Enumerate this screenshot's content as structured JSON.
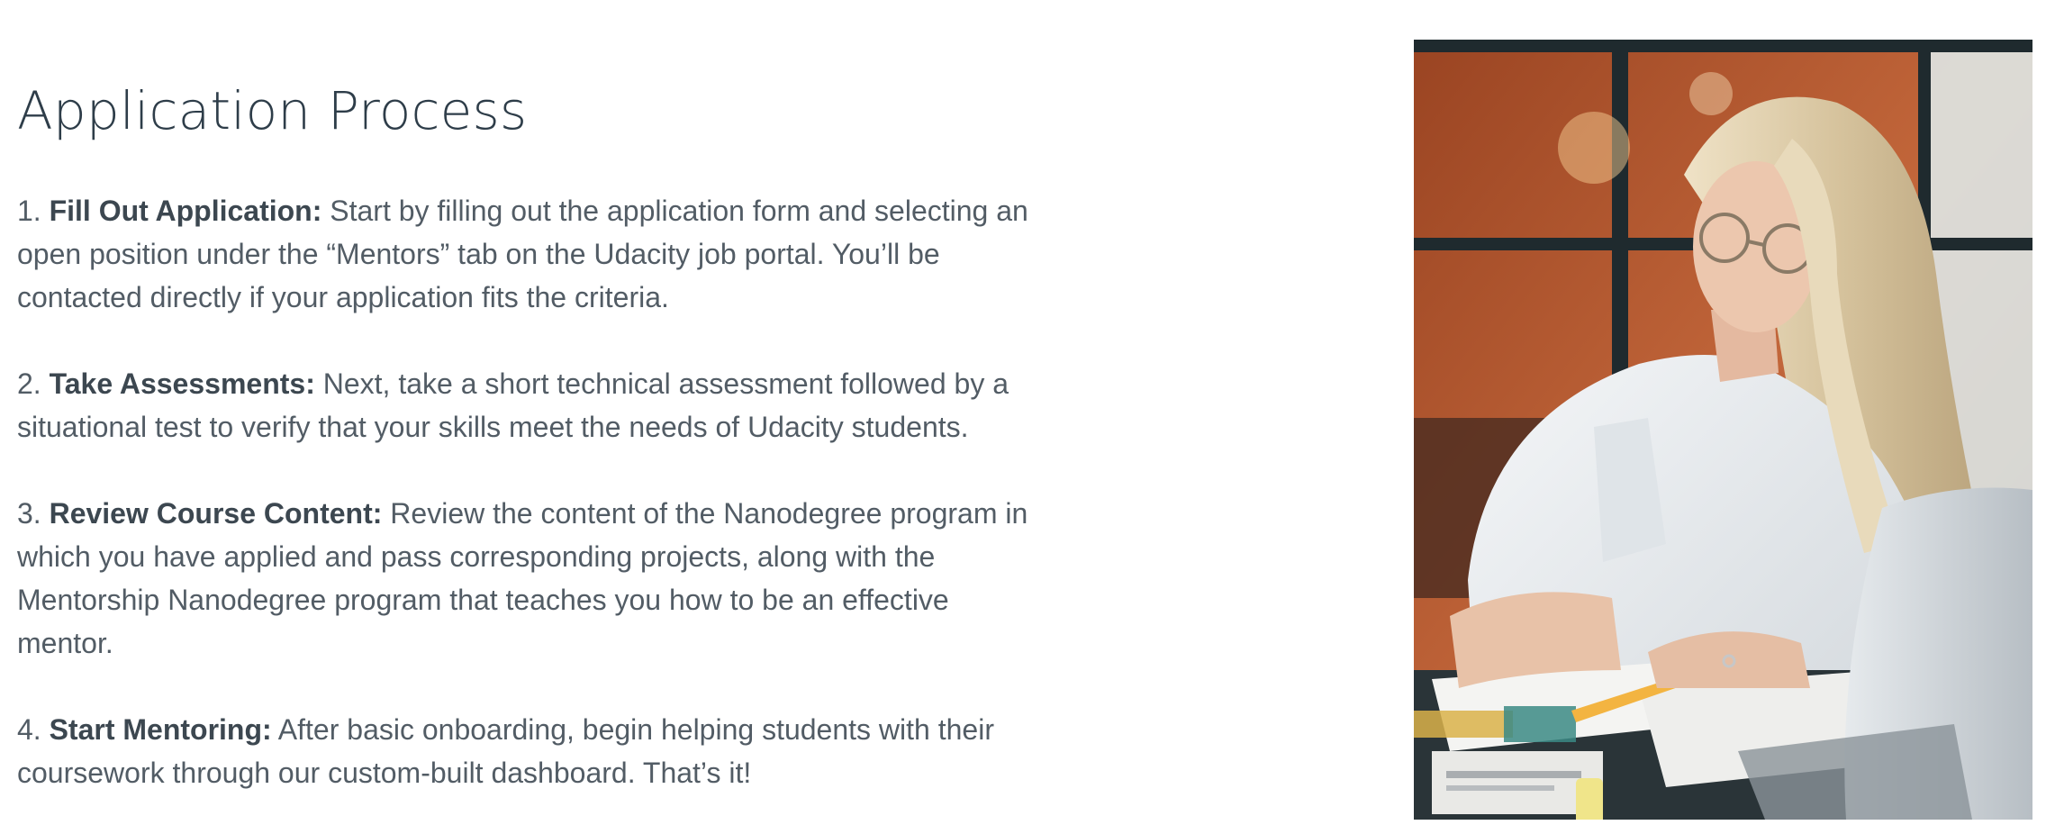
{
  "page": {
    "title": "Application Process",
    "steps": [
      {
        "number": "1.",
        "heading": "Fill Out Application:",
        "text": "Start by filling out the application form and selecting an open position under the “Mentors” tab on the Udacity job portal. You’ll be contacted directly if your application fits the criteria."
      },
      {
        "number": "2.",
        "heading": "Take Assessments:",
        "text": "Next, take a short technical assessment followed by a situational test to verify that your skills meet the needs of Udacity students."
      },
      {
        "number": "3.",
        "heading": "Review Course Content:",
        "text": "Review the content of the Nanodegree program in which you have applied and pass corresponding projects, along with the Mentorship Nanodegree program that teaches you how to be an effective mentor."
      },
      {
        "number": "4.",
        "heading": "Start Mentoring:",
        "text": "After basic onboarding, begin helping students with their coursework through our custom-built dashboard. That’s it!"
      }
    ]
  },
  "photo": {
    "subject": "woman with glasses reviewing papers at a desk with laptop",
    "colors": {
      "wall": "#b85a30",
      "window_frame": "#1f2a2e",
      "shirt": "#e9ecef",
      "hair": "#d9c9a8",
      "skin": "#e8c2a8",
      "desk": "#2a3438",
      "paper": "#f4f4f2",
      "laptop": "#cfd5da"
    }
  }
}
